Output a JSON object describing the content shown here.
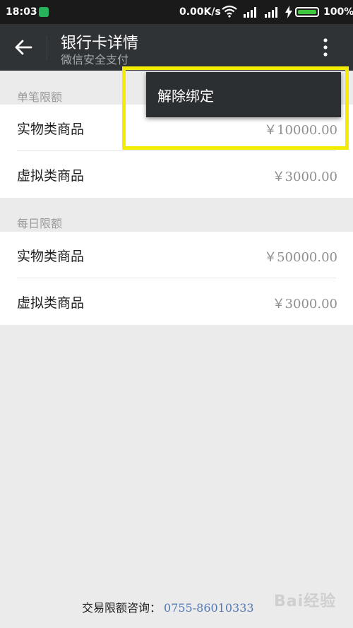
{
  "status_bar": {
    "time": "18:03",
    "network_speed": "0.00K/s",
    "battery_percent": "100%",
    "icons": [
      "shield-icon",
      "wifi-icon",
      "signal-icon",
      "signal-icon",
      "charging-icon",
      "battery-icon"
    ],
    "battery_color": "#3ec63e"
  },
  "header": {
    "back_icon": "arrow-left-icon",
    "title": "银行卡详情",
    "subtitle": "微信安全支付",
    "more_icon": "more-vertical-icon"
  },
  "single_limit": {
    "header": "单笔限额",
    "rows": [
      {
        "label": "实物类商品",
        "value": "￥10000.00"
      },
      {
        "label": "虚拟类商品",
        "value": "￥3000.00"
      }
    ]
  },
  "daily_limit": {
    "header": "每日限额",
    "rows": [
      {
        "label": "实物类商品",
        "value": "￥50000.00"
      },
      {
        "label": "虚拟类商品",
        "value": "￥3000.00"
      }
    ]
  },
  "popup_menu": {
    "items": [
      "解除绑定"
    ]
  },
  "highlight_color": "#f4ec00",
  "footer": {
    "label": "交易限额咨询：",
    "phone": "0755-86010333"
  },
  "watermark": "Bai经验"
}
